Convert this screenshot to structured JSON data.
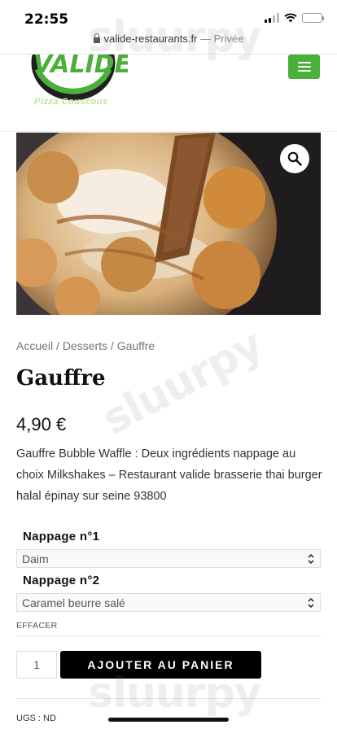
{
  "status_bar": {
    "time": "22:55"
  },
  "url_bar": {
    "domain": "valide-restaurants.fr",
    "separator": " — ",
    "privacy": "Privée"
  },
  "header": {
    "logo_text": "VALIDE",
    "logo_tagline": "Pizza Couscous"
  },
  "breadcrumb": {
    "items": [
      "Accueil",
      "Desserts",
      "Gauffre"
    ],
    "separator": " / "
  },
  "product": {
    "title": "Gauffre",
    "price": "4,90 €",
    "description": "Gauffre Bubble Waffle : Deux ingrédients nappage au choix Milkshakes – Restaurant valide brasserie thai burger halal épinay sur seine 93800"
  },
  "variations": [
    {
      "label": "Nappage n°1",
      "selected": "Daim"
    },
    {
      "label": "Nappage n°2",
      "selected": "Caramel beurre salé"
    }
  ],
  "reset_label": "EFFACER",
  "cart": {
    "quantity": "1",
    "button_label": "AJOUTER AU PANIER"
  },
  "meta": {
    "sku": "UGS : ND"
  },
  "watermark": "sluurpy",
  "colors": {
    "brand_green": "#4caf3c",
    "button_black": "#000000"
  }
}
